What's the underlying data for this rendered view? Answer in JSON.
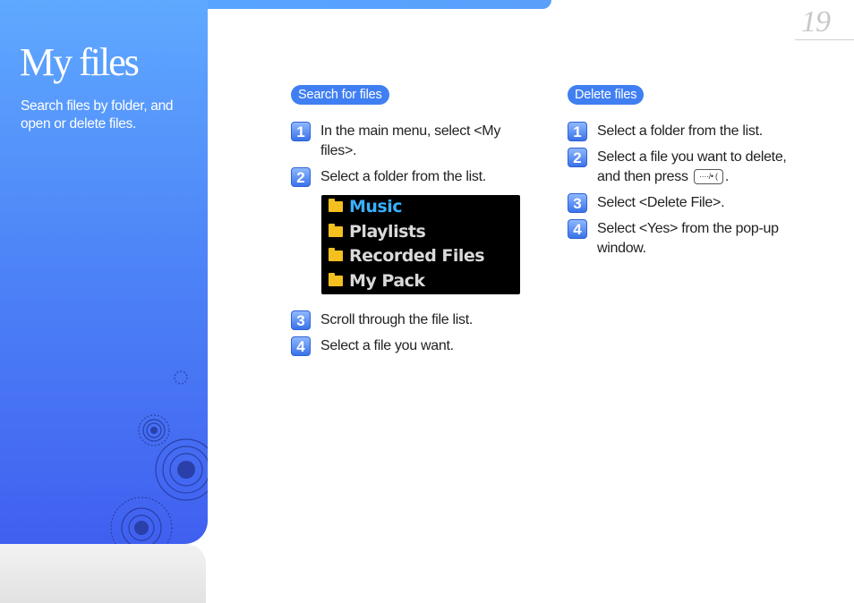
{
  "page": {
    "number": "19",
    "title": "My files",
    "subtitle": "Search files by folder, and open or delete files."
  },
  "search_section": {
    "heading": "Search for files",
    "steps": [
      {
        "num": "1",
        "text": "In the main menu, select <My files>."
      },
      {
        "num": "2",
        "text": "Select a folder from the list."
      },
      {
        "num": "3",
        "text": "Scroll through the file list."
      },
      {
        "num": "4",
        "text": "Select a file you want."
      }
    ]
  },
  "device_screen": {
    "folders": [
      {
        "label": "Music",
        "selected": true
      },
      {
        "label": "Playlists",
        "selected": false
      },
      {
        "label": "Recorded Files",
        "selected": false
      },
      {
        "label": "My Pack",
        "selected": false
      }
    ]
  },
  "delete_section": {
    "heading": "Delete files",
    "steps": [
      {
        "num": "1",
        "text": "Select a folder from the list."
      },
      {
        "num": "2",
        "text_before": "Select a file you want to delete, and then press",
        "key_label": "····/• (",
        "text_after": "."
      },
      {
        "num": "3",
        "text": "Select <Delete File>."
      },
      {
        "num": "4",
        "text": "Select <Yes> from the pop-up window."
      }
    ]
  },
  "icons": {
    "folder": "folder-icon",
    "menu_key": "menu-key-icon"
  },
  "colors": {
    "accent": "#3f7ff2",
    "selected_folder": "#39b0ff",
    "folder": "#f4c020"
  }
}
